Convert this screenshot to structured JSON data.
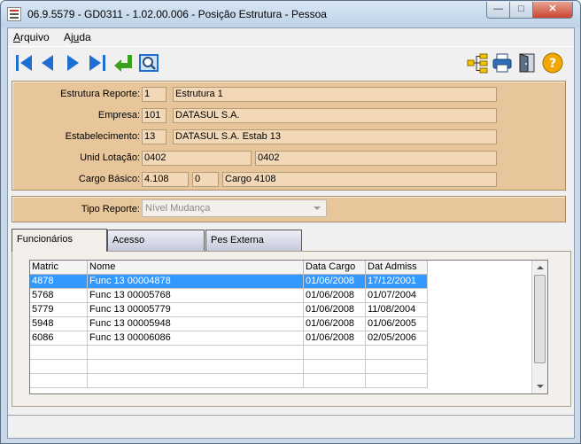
{
  "window": {
    "title": "06.9.5579 - GD0311 - 1.02.00.006 - Posição Estrutura - Pessoa"
  },
  "menu": {
    "items": [
      {
        "prefix": "",
        "accel": "A",
        "rest": "rquivo"
      },
      {
        "prefix": "Aj",
        "accel": "u",
        "rest": "da"
      }
    ]
  },
  "toolbar": {
    "nav": [
      "first-record-icon",
      "previous-record-icon",
      "next-record-icon",
      "last-record-icon",
      "return-icon",
      "zoom-icon"
    ],
    "right": [
      "structure-tree-icon",
      "print-icon",
      "exit-door-icon",
      "help-icon"
    ],
    "colors": {
      "nav": "#1f6fd1",
      "return": "#3aa11f",
      "help": "#f2a800"
    }
  },
  "header_fields": {
    "estrutura": {
      "label": "Estrutura Reporte:",
      "code": "1",
      "desc": "Estrutura 1"
    },
    "empresa": {
      "label": "Empresa:",
      "code": "101",
      "desc": "DATASUL S.A."
    },
    "estab": {
      "label": "Estabelecimento:",
      "code": "13",
      "desc": "DATASUL S.A. Estab 13"
    },
    "lotacao": {
      "label": "Unid Lotação:",
      "code": "0402",
      "desc": "0402"
    },
    "cargo": {
      "label": "Cargo Básico:",
      "code": "4.108",
      "code2": "0",
      "desc": "Cargo 4108"
    }
  },
  "tipo_reporte": {
    "label": "Tipo Reporte:",
    "value": "Nível Mudança"
  },
  "tabs": [
    "Funcionários",
    "Acesso",
    "Pes Externa"
  ],
  "table": {
    "columns": [
      "Matric",
      "Nome",
      "Data Cargo",
      "Dat Admiss"
    ],
    "rows": [
      [
        "4878",
        "Func 13 00004878",
        "01/06/2008",
        "17/12/2001"
      ],
      [
        "5768",
        "Func 13 00005768",
        "01/06/2008",
        "01/07/2004"
      ],
      [
        "5779",
        "Func 13 00005779",
        "01/06/2008",
        "11/08/2004"
      ],
      [
        "5948",
        "Func 13 00005948",
        "01/06/2008",
        "01/06/2005"
      ],
      [
        "6086",
        "Func 13 00006086",
        "01/06/2008",
        "02/05/2006"
      ]
    ]
  }
}
